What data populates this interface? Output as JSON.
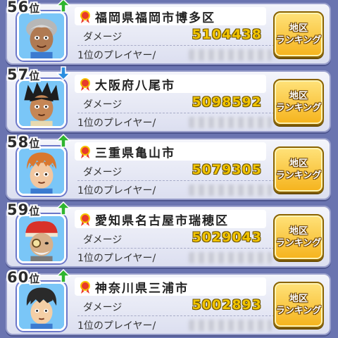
{
  "labels": {
    "damage": "ダメージ",
    "top_player": "1位のプレイヤー/",
    "button_line1": "地区",
    "button_line2": "ランキング",
    "rank_suffix": "位"
  },
  "rows": [
    {
      "rank": "56",
      "trend": "up",
      "region": "福岡県福岡市博多区",
      "damage": "5104438",
      "avatar": "grandma-face-icon"
    },
    {
      "rank": "57",
      "trend": "down",
      "region": "大阪府八尾市",
      "damage": "5098592",
      "avatar": "spiky-hair-boy-icon"
    },
    {
      "rank": "58",
      "trend": "up",
      "region": "三重県亀山市",
      "damage": "5079305",
      "avatar": "orange-hair-boy-icon"
    },
    {
      "rank": "59",
      "trend": "up",
      "region": "愛知県名古屋市瑞穂区",
      "damage": "5029043",
      "avatar": "old-man-red-cap-icon"
    },
    {
      "rank": "60",
      "trend": "up",
      "region": "神奈川県三浦市",
      "damage": "5002893",
      "avatar": "black-hair-boy-icon"
    }
  ],
  "colors": {
    "up_arrow": "#2fb52f",
    "down_arrow": "#2a8ee0",
    "damage_value": "#f2c400",
    "button": "#f5b31c",
    "background": "#6a74b0"
  }
}
